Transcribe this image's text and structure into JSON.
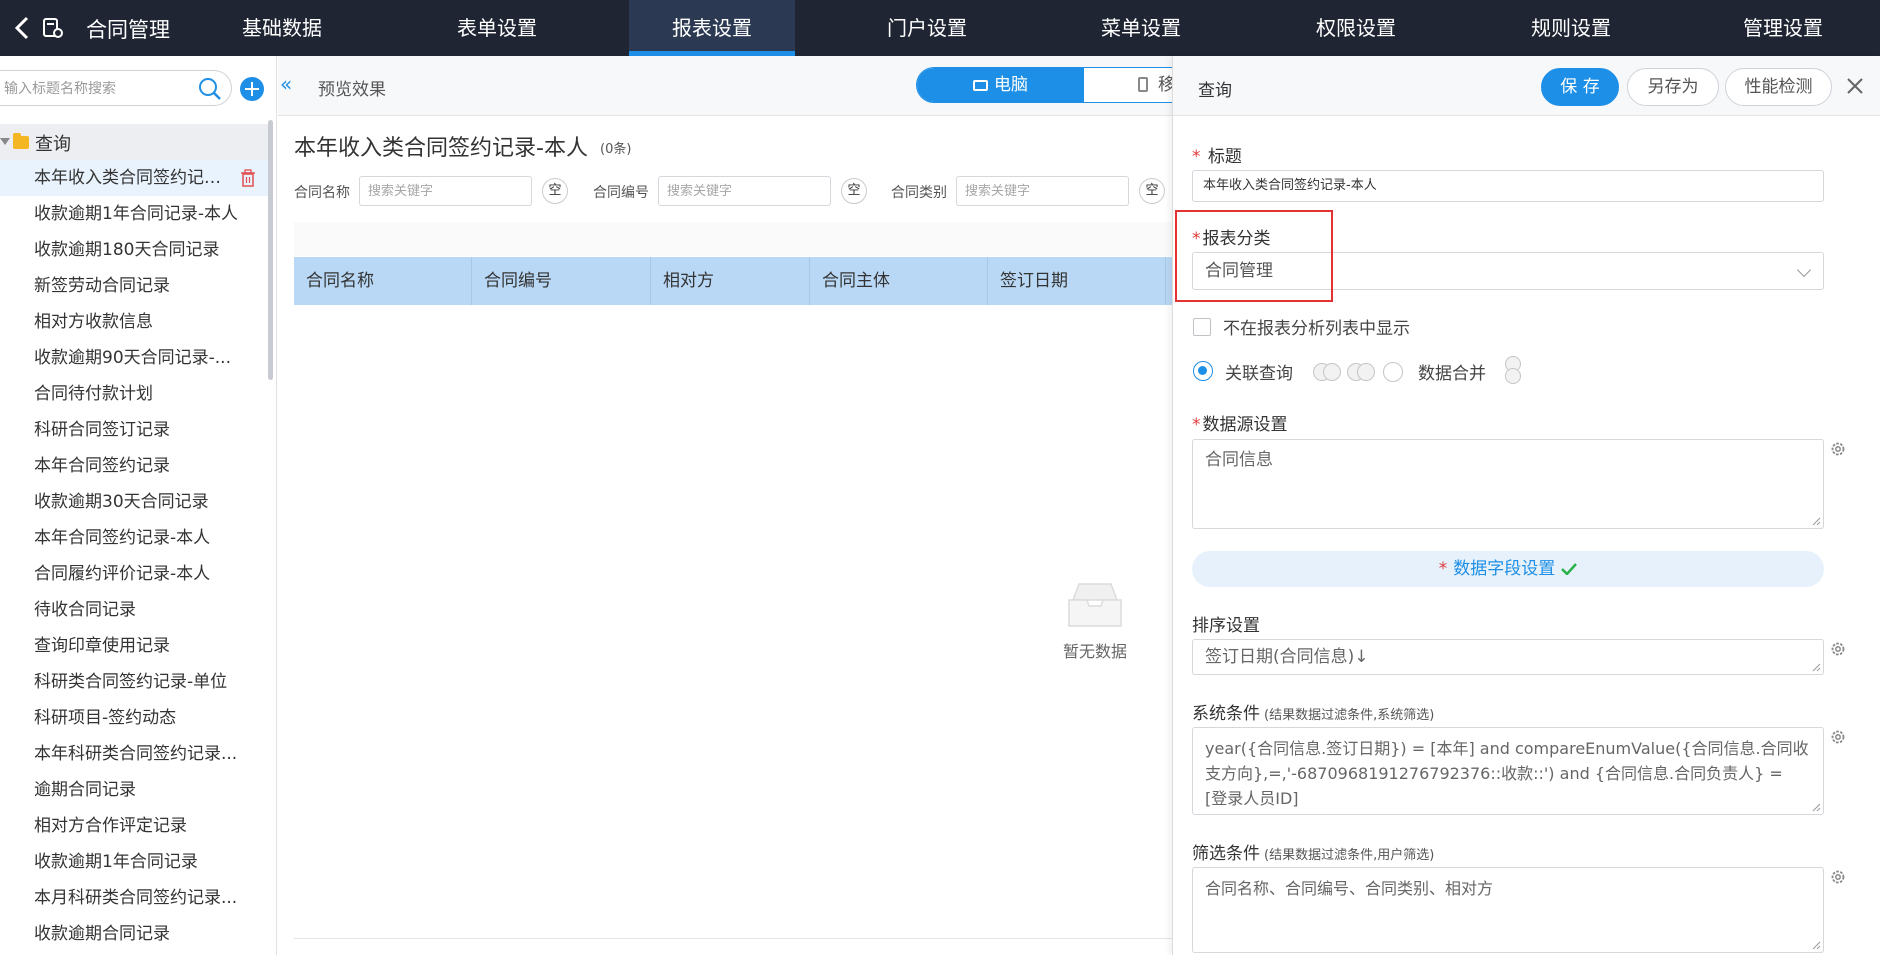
{
  "topnav": {
    "app_title": "合同管理",
    "items": [
      {
        "label": "基础数据"
      },
      {
        "label": "表单设置"
      },
      {
        "label": "报表设置"
      },
      {
        "label": "门户设置"
      },
      {
        "label": "菜单设置"
      },
      {
        "label": "权限设置"
      },
      {
        "label": "规则设置"
      },
      {
        "label": "管理设置"
      }
    ],
    "active_index": 2
  },
  "sidebar": {
    "search_placeholder": "输入标题名称搜索",
    "group_label": "查询",
    "items": [
      {
        "label": "本年收入类合同签约记录..."
      },
      {
        "label": "收款逾期1年合同记录-本人"
      },
      {
        "label": "收款逾期180天合同记录"
      },
      {
        "label": "新签劳动合同记录"
      },
      {
        "label": "相对方收款信息"
      },
      {
        "label": "收款逾期90天合同记录-..."
      },
      {
        "label": "合同待付款计划"
      },
      {
        "label": "科研合同签订记录"
      },
      {
        "label": "本年合同签约记录"
      },
      {
        "label": "收款逾期30天合同记录"
      },
      {
        "label": "本年合同签约记录-本人"
      },
      {
        "label": "合同履约评价记录-本人"
      },
      {
        "label": "待收合同记录"
      },
      {
        "label": "查询印章使用记录"
      },
      {
        "label": "科研类合同签约记录-单位"
      },
      {
        "label": "科研项目-签约动态"
      },
      {
        "label": "本年科研类合同签约记录..."
      },
      {
        "label": "逾期合同记录"
      },
      {
        "label": "相对方合作评定记录"
      },
      {
        "label": "收款逾期1年合同记录"
      },
      {
        "label": "本月科研类合同签约记录..."
      },
      {
        "label": "收款逾期合同记录"
      }
    ]
  },
  "preview": {
    "header_title": "预览效果",
    "view_pc": "电脑",
    "view_mobile": "移",
    "report_title": "本年收入类合同签约记录-本人",
    "count": "(0条)",
    "filters": [
      {
        "label": "合同名称",
        "placeholder": "搜索关键字",
        "btn": "空"
      },
      {
        "label": "合同编号",
        "placeholder": "搜索关键字",
        "btn": "空"
      },
      {
        "label": "合同类别",
        "placeholder": "搜索关键字",
        "btn": "空"
      }
    ],
    "columns": [
      "合同名称",
      "合同编号",
      "相对方",
      "合同主体",
      "签订日期"
    ],
    "empty_text": "暂无数据"
  },
  "panel": {
    "title": "查询",
    "save": "保 存",
    "save_as": "另存为",
    "perf_check": "性能检测",
    "req_mark": "*",
    "title_label": "标题",
    "title_value": "本年收入类合同签约记录-本人",
    "category_label": "报表分类",
    "category_value": "合同管理",
    "hide_checkbox_label": "不在报表分析列表中显示",
    "radio_join_label": "关联查询",
    "radio_merge_label": "数据合并",
    "datasource_label": "数据源设置",
    "datasource_value": "合同信息",
    "data_fields_label": "数据字段设置",
    "sort_label": "排序设置",
    "sort_value": "签订日期(合同信息)↓",
    "system_cond_label": "系统条件",
    "system_cond_hint": "(结果数据过滤条件,系统筛选)",
    "system_cond_value": "year({合同信息.签订日期}) = [本年] and compareEnumValue({合同信息.合同收支方向},=,'-6870968191276792376::收款::') and {合同信息.合同负责人} = [登录人员ID]",
    "filter_cond_label": "筛选条件",
    "filter_cond_hint": "(结果数据过滤条件,用户筛选)",
    "filter_cond_value": "合同名称、合同编号、合同类别、相对方"
  },
  "colors": {
    "nav_bg": "#1f2533",
    "accent": "#1e8fe6",
    "table_head": "#b9d8f5",
    "highlight": "#e23232"
  }
}
